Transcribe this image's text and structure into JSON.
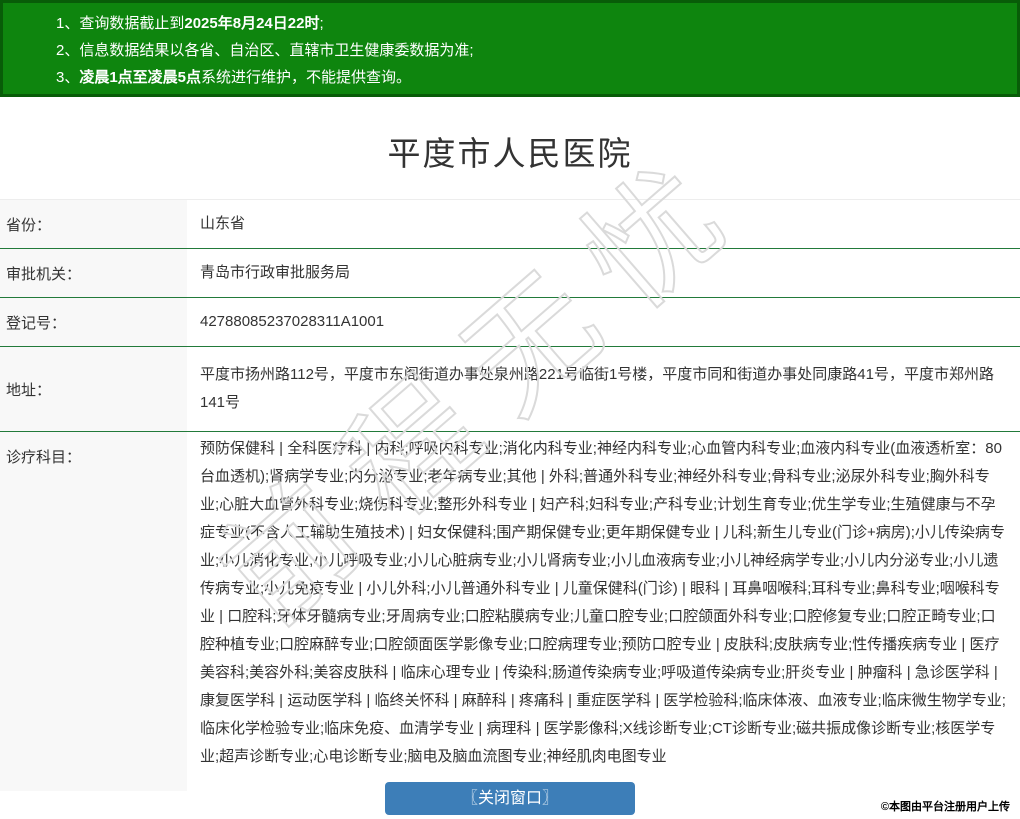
{
  "header": {
    "notices": [
      {
        "num": "1、",
        "pre": "查询数据截止到",
        "strong": "2025年8月24日22时",
        "post": ";"
      },
      {
        "num": "2、",
        "pre": "信息数据结果以各省、自治区、直辖市卫生健康委数据为准;",
        "strong": "",
        "post": ""
      },
      {
        "num": "3、",
        "pre": "",
        "strong": "凌晨1点至凌晨5点",
        "post": "系统进行维护，不能提供查询。"
      }
    ]
  },
  "title": "平度市人民医院",
  "info_table": {
    "rows": [
      {
        "label": "省份：",
        "value": "山东省"
      },
      {
        "label": "审批机关：",
        "value": "青岛市行政审批服务局"
      },
      {
        "label": "登记号：",
        "value": "42788085237028311A1001"
      },
      {
        "label": "地址：",
        "value": "平度市扬州路112号，平度市东阁街道办事处泉州路221号临街1号楼，平度市同和街道办事处同康路41号，平度市郑州路141号"
      },
      {
        "label": "诊疗科目：",
        "value": "预防保健科 | 全科医疗科 | 内科;呼吸内科专业;消化内科专业;神经内科专业;心血管内科专业;血液内科专业(血液透析室：80台血透机);肾病学专业;内分泌专业;老年病专业;其他 | 外科;普通外科专业;神经外科专业;骨科专业;泌尿外科专业;胸外科专业;心脏大血管外科专业;烧伤科专业;整形外科专业 | 妇产科;妇科专业;产科专业;计划生育专业;优生学专业;生殖健康与不孕症专业(不含人工辅助生殖技术) | 妇女保健科;围产期保健专业;更年期保健专业 | 儿科;新生儿专业(门诊+病房);小儿传染病专业;小儿消化专业;小儿呼吸专业;小儿心脏病专业;小儿肾病专业;小儿血液病专业;小儿神经病学专业;小儿内分泌专业;小儿遗传病专业;小儿免疫专业 | 小儿外科;小儿普通外科专业 | 儿童保健科(门诊) | 眼科 | 耳鼻咽喉科;耳科专业;鼻科专业;咽喉科专业 | 口腔科;牙体牙髓病专业;牙周病专业;口腔粘膜病专业;儿童口腔专业;口腔颌面外科专业;口腔修复专业;口腔正畸专业;口腔种植专业;口腔麻醉专业;口腔颌面医学影像专业;口腔病理专业;预防口腔专业 | 皮肤科;皮肤病专业;性传播疾病专业 | 医疗美容科;美容外科;美容皮肤科 | 临床心理专业 | 传染科;肠道传染病专业;呼吸道传染病专业;肝炎专业 | 肿瘤科 | 急诊医学科 | 康复医学科 | 运动医学科 | 临终关怀科 | 麻醉科 | 疼痛科 | 重症医学科 | 医学检验科;临床体液、血液专业;临床微生物学专业;临床化学检验专业;临床免疫、血清学专业 | 病理科 | 医学影像科;X线诊断专业;CT诊断专业;磁共振成像诊断专业;核医学专业;超声诊断专业;心电诊断专业;脑电及脑血流图专业;神经肌肉电图专业"
      }
    ]
  },
  "watermark_text": "前程无忧",
  "close_button_label": "〖关闭窗口〗",
  "copyright_note": "©本图由平台注册用户上传",
  "colors": {
    "header_green": "#0e850e",
    "header_border_green": "#085c08",
    "row_separator_green": "#227a3a",
    "label_cell_bg": "#f8f8f8",
    "button_blue": "#3d7eb8",
    "body_text": "#333333",
    "watermark_gray": "#dadada"
  }
}
